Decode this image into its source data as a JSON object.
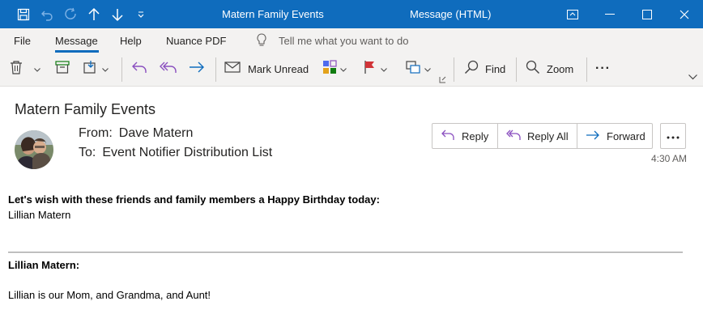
{
  "window": {
    "title": "Matern Family Events",
    "mode": "Message (HTML)"
  },
  "menu": {
    "items": [
      "File",
      "Message",
      "Help",
      "Nuance PDF"
    ],
    "active": "Message",
    "tell_me": "Tell me what you want to do"
  },
  "ribbon": {
    "mark_unread": "Mark Unread",
    "find": "Find",
    "zoom": "Zoom",
    "more": "···"
  },
  "message": {
    "subject": "Matern Family Events",
    "from_label": "From:",
    "from": "Dave Matern",
    "to_label": "To:",
    "to": "Event Notifier Distribution List",
    "time": "4:30 AM",
    "actions": {
      "reply": "Reply",
      "reply_all": "Reply All",
      "forward": "Forward"
    },
    "body": {
      "intro": "Let's wish with these friends and family members a Happy Birthday today:",
      "name_line": "Lillian Matern",
      "section_heading": "Lillian Matern:",
      "section_text": "Lillian is our Mom, and Grandma, and Aunt!"
    }
  },
  "colors": {
    "titlebar": "#0f6cbd",
    "ribbon_bg": "#f3f2f1",
    "accent_purple": "#8a4fbf",
    "accent_blue": "#0f6cbd",
    "flag_red": "#d13438"
  }
}
